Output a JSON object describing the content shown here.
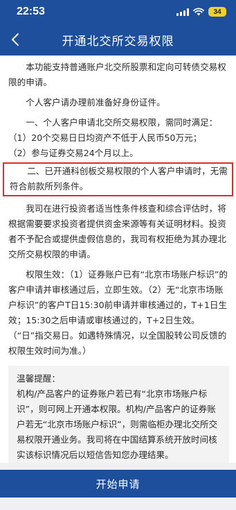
{
  "status_bar": {
    "time": "22:53",
    "battery": "34",
    "icons": [
      "signal-icon",
      "wifi-icon",
      "battery-icon"
    ],
    "battery_color": "#f2d02a"
  },
  "nav": {
    "title": "开通北交所交易权限",
    "back_icon": "chevron-left-icon",
    "background_color": "#1d4f9c"
  },
  "content": {
    "intro": "本功能支持普通账户北交所股票和定向可转债交易权限的申请。",
    "id_note": "个人客户请办理前准备好身份证件。",
    "condition_one": "一、个人客户申请北交所交易权限，需同时满足：",
    "condition_one_items": [
      "（1）20个交易日日均资产不低于人民币50万元；",
      "（2）参与证券交易24个月以上。"
    ],
    "condition_two": "二、已开通科创板交易权限的个人客户申请时，无需符合前款所列条件。",
    "review_note": "我司在进行投资者适当性条件核查和综合评估时，将根据需要要求投资者提供资金来源等有关证明材料。投资者不予配合或提供虚假信息的，我司有权拒绝为其办理北交所交易权限的申请。",
    "effective_note": "权限生效：（1）证券账户已有“北京市场账户标识”的客户申请并审核通过后，立即生效。（2）无“北京市场账户标识”的客户T日15:30前申请并审核通过的，T+1日生效；15:30之后申请或审核通过的，T+2日生效。（“日”指交易日。如遇特殊情况，以全国股转公司反馈的权限生效时间为准。）",
    "highlight_color": "#e02b2b"
  },
  "reminder": {
    "title": "温馨提醒：",
    "text": "机构/产品客户的证券账户若已有“北京市场账户标识”，则可网上开通本权限。机构/产品客户的证券账户若无“北京市场账户标识”，则需临柜办理北交所交易权限开通业务。我司将在中国结算系统开放时间核实该标识情况后以短信告知您办理结果。"
  },
  "footer": {
    "apply_label": "开始申请"
  }
}
